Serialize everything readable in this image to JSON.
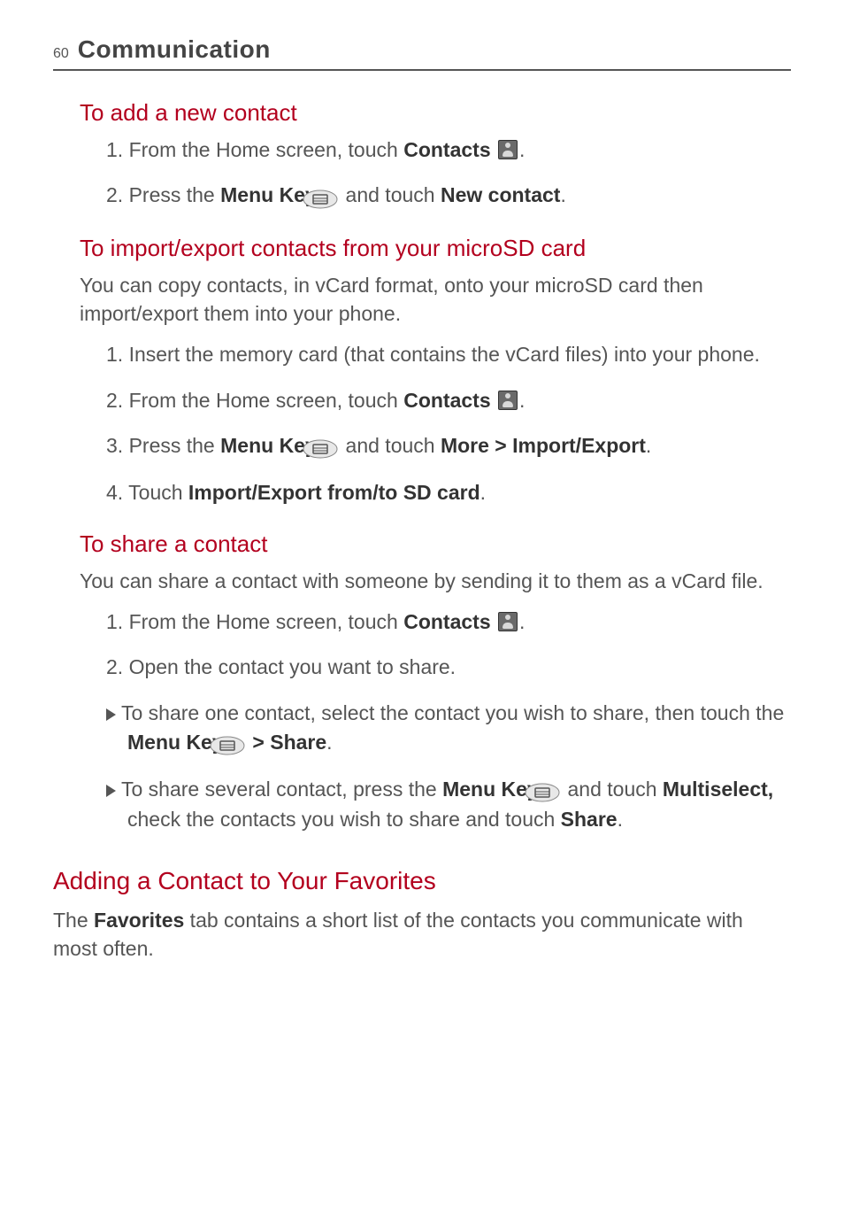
{
  "header": {
    "page_number": "60",
    "section_title": "Communication"
  },
  "sec_add": {
    "heading": "To add a new contact",
    "step1_pre": "1. From the Home screen, touch ",
    "step1_bold": "Contacts",
    "step1_post": ".",
    "step2_pre": "2. Press the ",
    "step2_bold1": "Menu Key",
    "step2_mid": " and touch ",
    "step2_bold2": "New contact",
    "step2_post": "."
  },
  "sec_import": {
    "heading": "To import/export contacts from your microSD card",
    "intro": "You can copy contacts, in vCard format, onto your microSD card then import/export them into your phone.",
    "step1": "1. Insert the memory card (that contains the vCard files) into your phone.",
    "step2_pre": "2. From the Home screen, touch ",
    "step2_bold": "Contacts",
    "step2_post": ".",
    "step3_pre": "3. Press the ",
    "step3_bold1": "Menu Key",
    "step3_mid": " and touch ",
    "step3_bold2": "More > Import/Export",
    "step3_post": ".",
    "step4_pre": "4. Touch ",
    "step4_bold": "Import/Export from/to SD card",
    "step4_post": "."
  },
  "sec_share": {
    "heading": "To share a contact",
    "intro": "You can share a contact with someone by sending it to them as a vCard file.",
    "step1_pre": "1. From the Home screen, touch ",
    "step1_bold": "Contacts",
    "step1_post": ".",
    "step2": "2. Open the contact you want to share.",
    "b1_pre": "To share one contact, select the contact you wish to share, then touch the ",
    "b1_bold1": "Menu Key",
    "b1_mid": " ",
    "b1_bold2": "> Share",
    "b1_post": ".",
    "b2_pre": "To share several contact, press the ",
    "b2_bold1": "Menu Key",
    "b2_mid1": " and touch ",
    "b2_bold2": "Multiselect,",
    "b2_mid2": " check the contacts you wish to share and touch ",
    "b2_bold3": "Share",
    "b2_post": "."
  },
  "sec_fav": {
    "heading": "Adding a Contact to Your Favorites",
    "para_pre": "The ",
    "para_bold": "Favorites",
    "para_post": " tab contains a short list of the contacts you communicate with most often."
  }
}
